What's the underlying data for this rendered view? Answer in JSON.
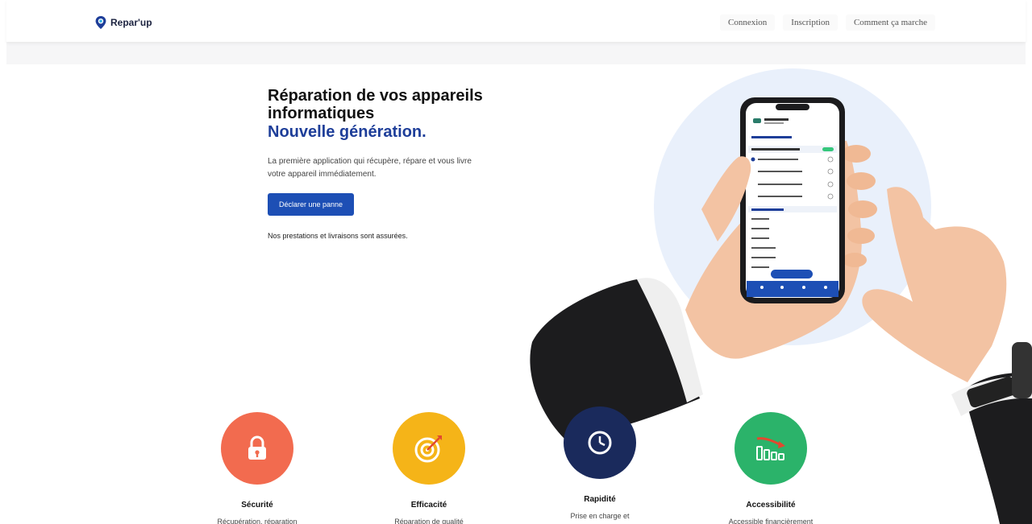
{
  "header": {
    "logo_text": "Repar'up",
    "nav": [
      {
        "label": "Connexion"
      },
      {
        "label": "Inscription"
      },
      {
        "label": "Comment ça marche"
      }
    ]
  },
  "hero": {
    "title_line1": "Réparation de vos appareils",
    "title_line2": "informatiques",
    "title_accent": "Nouvelle génération.",
    "description": "La première application qui récupère, répare et vous livre votre appareil immédiatement.",
    "cta_label": "Déclarer une panne",
    "note": "Nos prestations et livraisons sont assurées."
  },
  "features": [
    {
      "title": "Sécurité",
      "desc": "Récupération, réparation",
      "icon": "lock-icon",
      "color": "#f26b4f"
    },
    {
      "title": "Efficacité",
      "desc": "Réparation de qualité",
      "icon": "target-icon",
      "color": "#f5b418"
    },
    {
      "title": "Rapidité",
      "desc": "Prise en charge et",
      "icon": "clock-icon",
      "color": "#1a2a5c"
    },
    {
      "title": "Accessibilité",
      "desc": "Accessible financièrement",
      "icon": "chart-icon",
      "color": "#2bb36a"
    }
  ],
  "colors": {
    "brand": "#1e3e99",
    "cta": "#1d4fb5"
  }
}
